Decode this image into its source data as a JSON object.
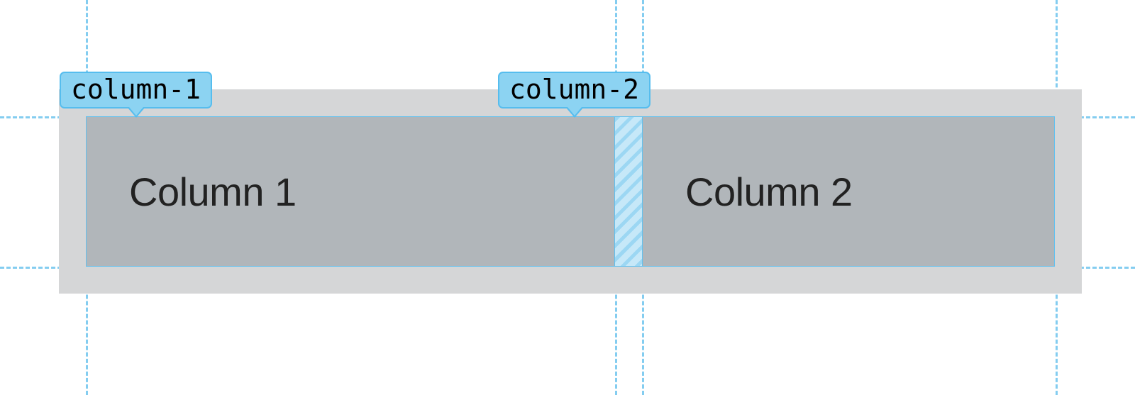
{
  "labels": {
    "col1": "column-1",
    "col2": "column-2"
  },
  "columns": {
    "col1_text": "Column 1",
    "col2_text": "Column 2"
  },
  "guides": {
    "horizontal": [
      164,
      376
    ],
    "vertical": [
      121,
      867,
      905,
      1488
    ]
  }
}
